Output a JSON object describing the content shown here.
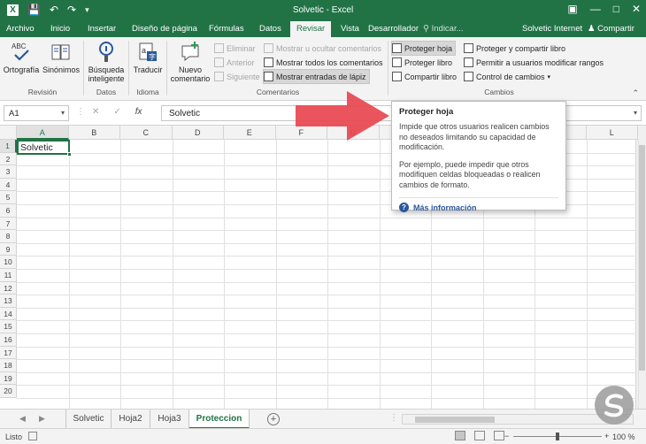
{
  "window": {
    "title": "Solvetic - Excel"
  },
  "ribbon_tabs": [
    {
      "label": "Archivo"
    },
    {
      "label": "Inicio"
    },
    {
      "label": "Insertar"
    },
    {
      "label": "Diseño de página"
    },
    {
      "label": "Fórmulas"
    },
    {
      "label": "Datos"
    },
    {
      "label": "Revisar"
    },
    {
      "label": "Vista"
    },
    {
      "label": "Desarrollador"
    }
  ],
  "active_tab": "Revisar",
  "tell_me": "Indicar...",
  "user_name": "Solvetic Internet",
  "share_label": "Compartir",
  "groups": {
    "revision": {
      "label": "Revisión",
      "ortografia": "Ortografía",
      "sinonimos": "Sinónimos"
    },
    "datos": {
      "label": "Datos",
      "busqueda_line1": "Búsqueda",
      "busqueda_line2": "inteligente"
    },
    "idioma": {
      "label": "Idioma",
      "traducir": "Traducir"
    },
    "comentarios": {
      "label": "Comentarios",
      "nuevo_line1": "Nuevo",
      "nuevo_line2": "comentario",
      "eliminar": "Eliminar",
      "anterior": "Anterior",
      "siguiente": "Siguiente",
      "mostrar_ocultar": "Mostrar u ocultar comentarios",
      "mostrar_todos": "Mostrar todos los comentarios",
      "mostrar_lapiz": "Mostrar entradas de lápiz"
    },
    "cambios": {
      "label": "Cambios",
      "proteger_hoja": "Proteger hoja",
      "proteger_libro": "Proteger libro",
      "compartir_libro": "Compartir libro",
      "proteger_compartir": "Proteger y compartir libro",
      "permitir_usuarios": "Permitir a usuarios modificar rangos",
      "control_cambios": "Control de cambios"
    }
  },
  "formula_bar": {
    "name_box": "A1",
    "fx": "fx",
    "content": "Solvetic"
  },
  "grid": {
    "columns": [
      "A",
      "B",
      "C",
      "D",
      "E",
      "F",
      "G",
      "H",
      "I",
      "J",
      "K",
      "L"
    ],
    "rows": [
      "1",
      "2",
      "3",
      "4",
      "5",
      "6",
      "7",
      "8",
      "9",
      "10",
      "11",
      "12",
      "13",
      "14",
      "15",
      "16",
      "17",
      "18",
      "19",
      "20"
    ],
    "cell_a1": "Solvetic"
  },
  "tooltip": {
    "title": "Proteger hoja",
    "body1": "Impide que otros usuarios realicen cambios no deseados limitando su capacidad de modificación.",
    "body2": "Por ejemplo, puede impedir que otros modifiquen celdas bloqueadas o realicen cambios de formato.",
    "more": "Más información"
  },
  "sheets": [
    {
      "label": "Solvetic"
    },
    {
      "label": "Hoja2"
    },
    {
      "label": "Hoja3"
    },
    {
      "label": "Proteccion"
    }
  ],
  "active_sheet": "Proteccion",
  "status": {
    "ready": "Listo",
    "zoom": "100 %"
  },
  "colors": {
    "excel_green": "#217346",
    "arrow_red": "#e8464f",
    "link_blue": "#2b579a"
  }
}
